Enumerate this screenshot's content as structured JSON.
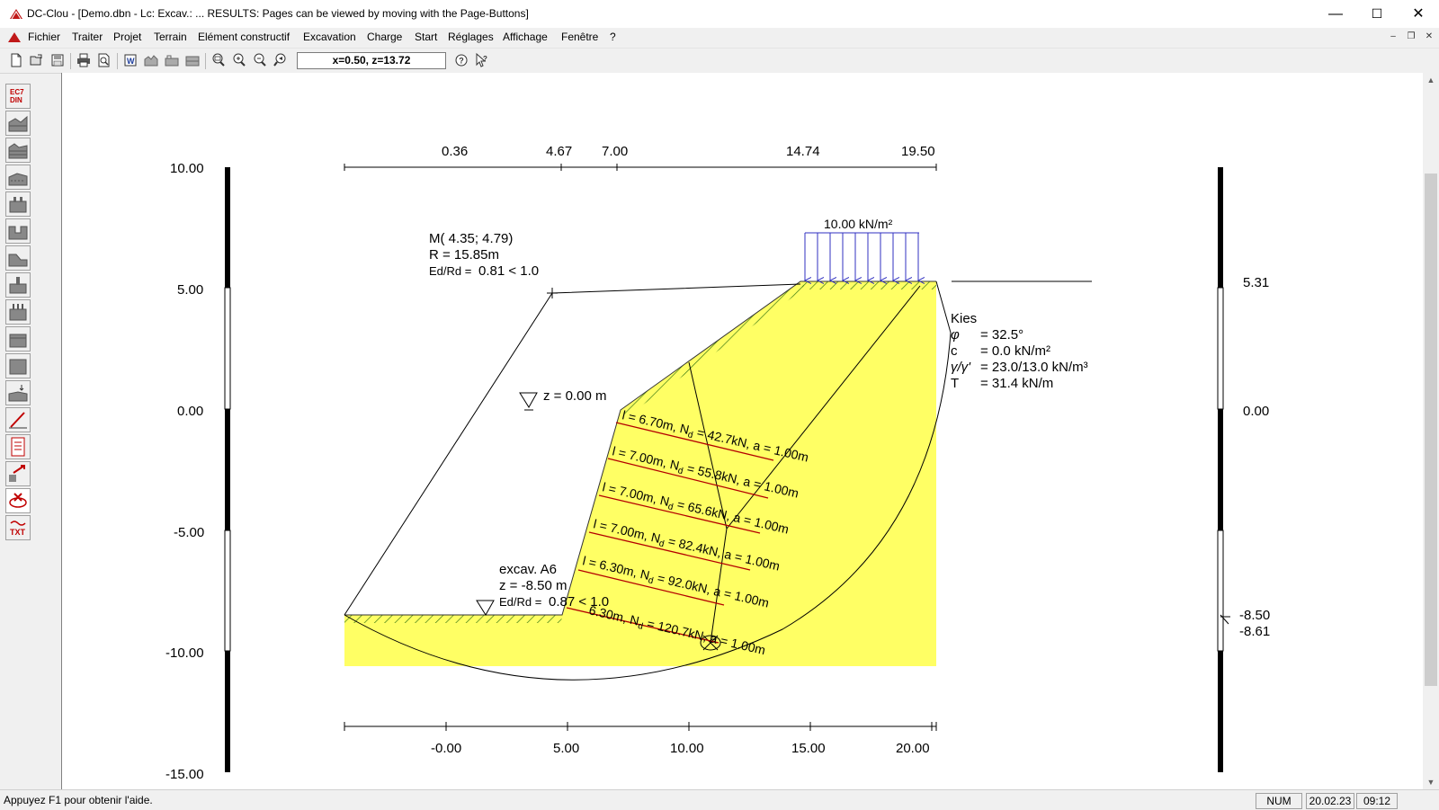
{
  "window": {
    "title": "DC-Clou - [Demo.dbn -  Lc:  Excav.:  ... RESULTS: Pages can be viewed by moving with the Page-Buttons]",
    "minimize": "—",
    "maximize": "☐",
    "close": "✕"
  },
  "menu": {
    "items": [
      "Fichier",
      "Traiter",
      "Projet",
      "Terrain",
      "Elément constructif",
      "Excavation",
      "Charge",
      "Start",
      "Réglages",
      "Affichage",
      "Fenêtre",
      "?"
    ],
    "mdi_min": "–",
    "mdi_restore": "❐",
    "mdi_close": "✕"
  },
  "toolbar": {
    "coord_readout": "x=0.50, z=13.72",
    "icons": [
      "new-file-icon",
      "open-file-icon",
      "save-icon",
      "print-icon",
      "print-preview-icon",
      "word-export-icon",
      "excavation-tool-1-icon",
      "excavation-tool-2-icon",
      "excavation-tool-3-icon",
      "zoom-all-icon",
      "zoom-in-icon",
      "zoom-out-icon",
      "zoom-previous-icon",
      "help-icon",
      "context-help-icon"
    ]
  },
  "left_toolbar": {
    "ec7_label_1": "EC7",
    "ec7_label_2": "DIN",
    "txt_label": "TXT"
  },
  "drawing": {
    "top_scale_labels": [
      "0.36",
      "4.67",
      "7.00",
      "14.74",
      "19.50"
    ],
    "left_axis_labels": [
      "10.00",
      "5.00",
      "0.00",
      "-5.00",
      "-10.00",
      "-15.00"
    ],
    "right_axis_labels": [
      "5.31",
      "0.00",
      "-8.50",
      "-8.61"
    ],
    "bottom_axis_labels": [
      "-0.00",
      "5.00",
      "10.00",
      "15.00",
      "20.00"
    ],
    "load_label": "10.00 kN/m²",
    "circle_info": {
      "center": "M( 4.35; 4.79)",
      "radius": "R = 15.85m",
      "ratio_label": "Ed/Rd =",
      "ratio_value": "0.81 < 1.0"
    },
    "water_level": "z =  0.00 m",
    "excavation": {
      "name": "excav. A6",
      "depth": "z = -8.50 m",
      "ratio_label": "Ed/Rd =",
      "ratio_value": "0.87 < 1.0"
    },
    "soil": {
      "name": "Kies",
      "phi_symbol": "φ",
      "phi_value": "= 32.5°",
      "c_symbol": "c",
      "c_value": "=  0.0 kN/m²",
      "gamma_symbol": "γ/γ'",
      "gamma_value": "= 23.0/13.0 kN/m³",
      "t_symbol": "T",
      "t_value": "= 31.4 kN/m"
    },
    "anchors": [
      {
        "length": "l = 6.70m",
        "force": "N",
        "force_sub": "d",
        "force_value": " = 42.7kN, a = 1.00m"
      },
      {
        "length": "l = 7.00m",
        "force": "N",
        "force_sub": "d",
        "force_value": " = 55.8kN, a = 1.00m"
      },
      {
        "length": "l = 7.00m",
        "force": "N",
        "force_sub": "d",
        "force_value": " = 65.6kN, a = 1.00m"
      },
      {
        "length": "l = 7.00m",
        "force": "N",
        "force_sub": "d",
        "force_value": " = 82.4kN, a = 1.00m"
      },
      {
        "length": "l = 6.30m",
        "force": "N",
        "force_sub": "d",
        "force_value": " = 92.0kN, a = 1.00m"
      },
      {
        "length": "6.30m",
        "force": "N",
        "force_sub": "d",
        "force_value": " = 120.7kN, a = 1.00m"
      }
    ],
    "colors": {
      "soil_fill": "#ffff64",
      "anchor_line": "#b40000",
      "load_arrows": "#3030c0",
      "hatch": "#3a7a14"
    }
  },
  "status": {
    "message": "Appuyez F1 pour obtenir l'aide.",
    "num": "NUM",
    "date": "20.02.23",
    "time": "09:12"
  }
}
